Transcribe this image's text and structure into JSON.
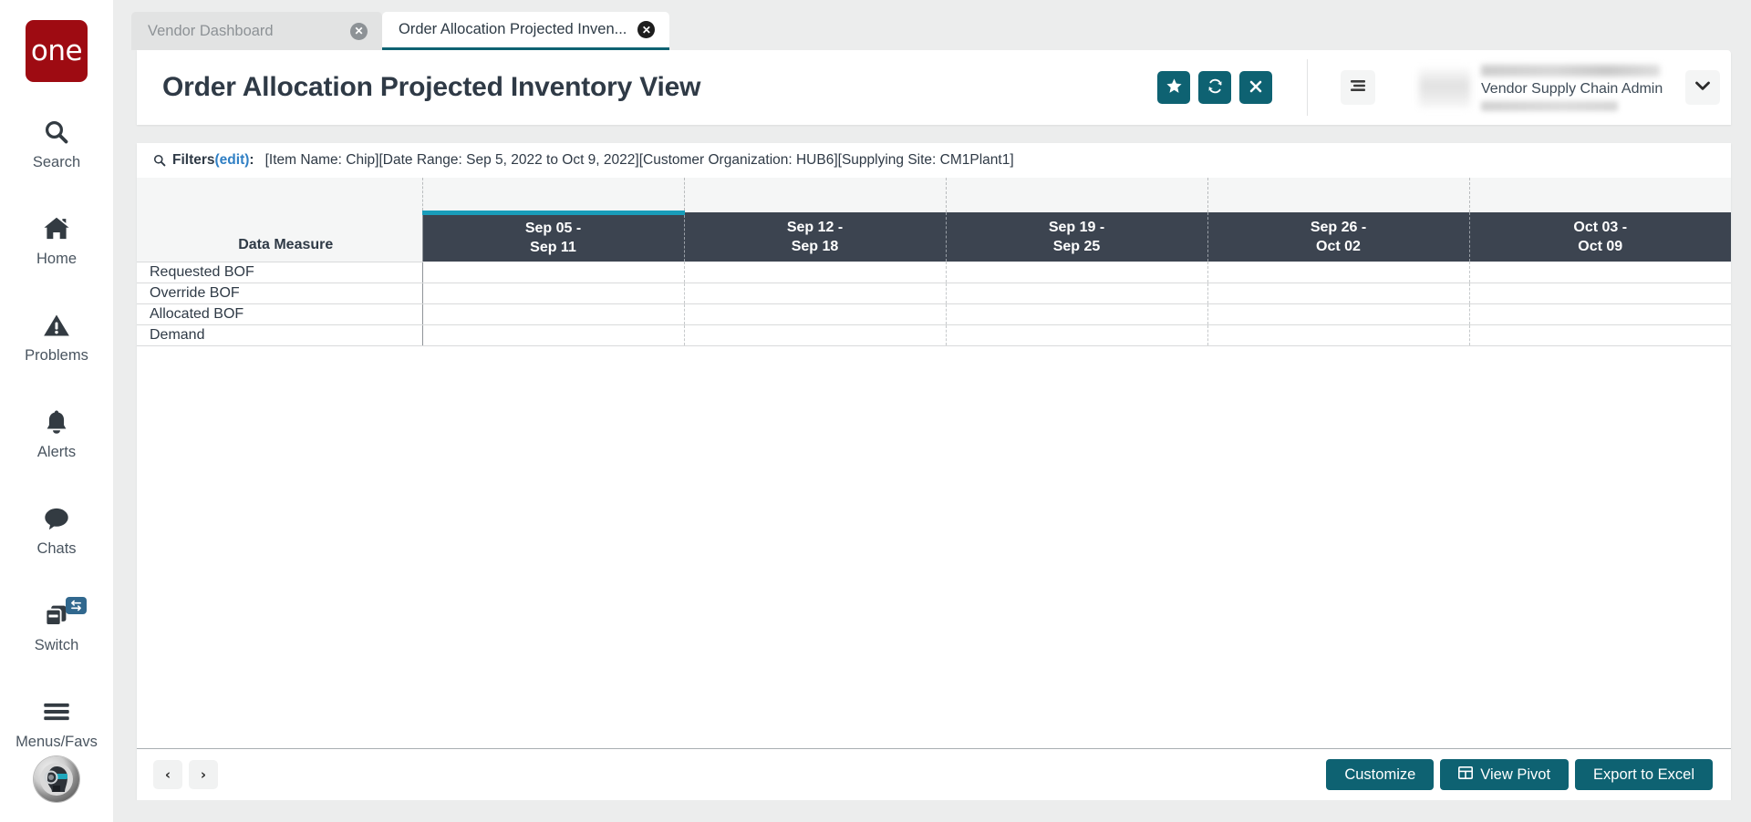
{
  "brand": {
    "logo_text": "one",
    "logo_color": "#9e0b12"
  },
  "theme": {
    "accent": "#0e6272",
    "header_row": "#3c4450",
    "highlight": "#199dba",
    "tab_active_underline": "#0e6272"
  },
  "sidebar": {
    "items": [
      {
        "label": "Search",
        "icon": "search-icon"
      },
      {
        "label": "Home",
        "icon": "home-icon"
      },
      {
        "label": "Problems",
        "icon": "warning-triangle-icon"
      },
      {
        "label": "Alerts",
        "icon": "bell-icon"
      },
      {
        "label": "Chats",
        "icon": "chat-bubble-icon"
      },
      {
        "label": "Switch",
        "icon": "switch-cards-icon"
      },
      {
        "label": "Menus/Favs",
        "icon": "hamburger-icon"
      }
    ],
    "assistant_avatar": "ai-assistant-avatar-icon"
  },
  "tabs": [
    {
      "label": "Vendor Dashboard",
      "active": false,
      "close_icon": "close-circle-icon"
    },
    {
      "label": "Order Allocation Projected Inven...",
      "active": true,
      "close_icon": "close-circle-icon"
    }
  ],
  "header": {
    "title": "Order Allocation Projected Inventory View",
    "actions": [
      {
        "name": "favorite-button",
        "icon": "star-icon"
      },
      {
        "name": "refresh-button",
        "icon": "refresh-icon"
      },
      {
        "name": "close-button",
        "icon": "x-icon"
      }
    ],
    "menu_icon": "list-menu-icon",
    "user": {
      "role": "Vendor Supply Chain Admin",
      "caret_icon": "chevron-down-icon"
    }
  },
  "filters": {
    "icon": "search-icon",
    "label": "Filters",
    "edit_label": "(edit)",
    "colon": ":",
    "value": "[Item Name: Chip][Date Range: Sep 5, 2022 to Oct 9, 2022][Customer Organization: HUB6][Supplying Site: CM1Plant1]"
  },
  "grid": {
    "measure_header": "Data Measure",
    "periods": [
      {
        "line1": "Sep 05 -",
        "line2": "Sep 11"
      },
      {
        "line1": "Sep 12 -",
        "line2": "Sep 18"
      },
      {
        "line1": "Sep 19 -",
        "line2": "Sep 25"
      },
      {
        "line1": "Sep 26 -",
        "line2": "Oct 02"
      },
      {
        "line1": "Oct 03 -",
        "line2": "Oct 09"
      }
    ],
    "rows": [
      {
        "measure": "Requested BOF",
        "values": [
          "",
          "",
          "",
          "",
          ""
        ]
      },
      {
        "measure": "Override BOF",
        "values": [
          "",
          "",
          "",
          "",
          ""
        ]
      },
      {
        "measure": "Allocated BOF",
        "values": [
          "",
          "",
          "",
          "",
          ""
        ]
      },
      {
        "measure": "Demand",
        "values": [
          "",
          "",
          "",
          "",
          ""
        ]
      }
    ]
  },
  "footer": {
    "prev_label": "‹",
    "next_label": "›",
    "buttons": [
      {
        "label": "Customize",
        "icon": null
      },
      {
        "label": "View Pivot",
        "icon": "grid-table-icon"
      },
      {
        "label": "Export to Excel",
        "icon": null
      }
    ]
  }
}
